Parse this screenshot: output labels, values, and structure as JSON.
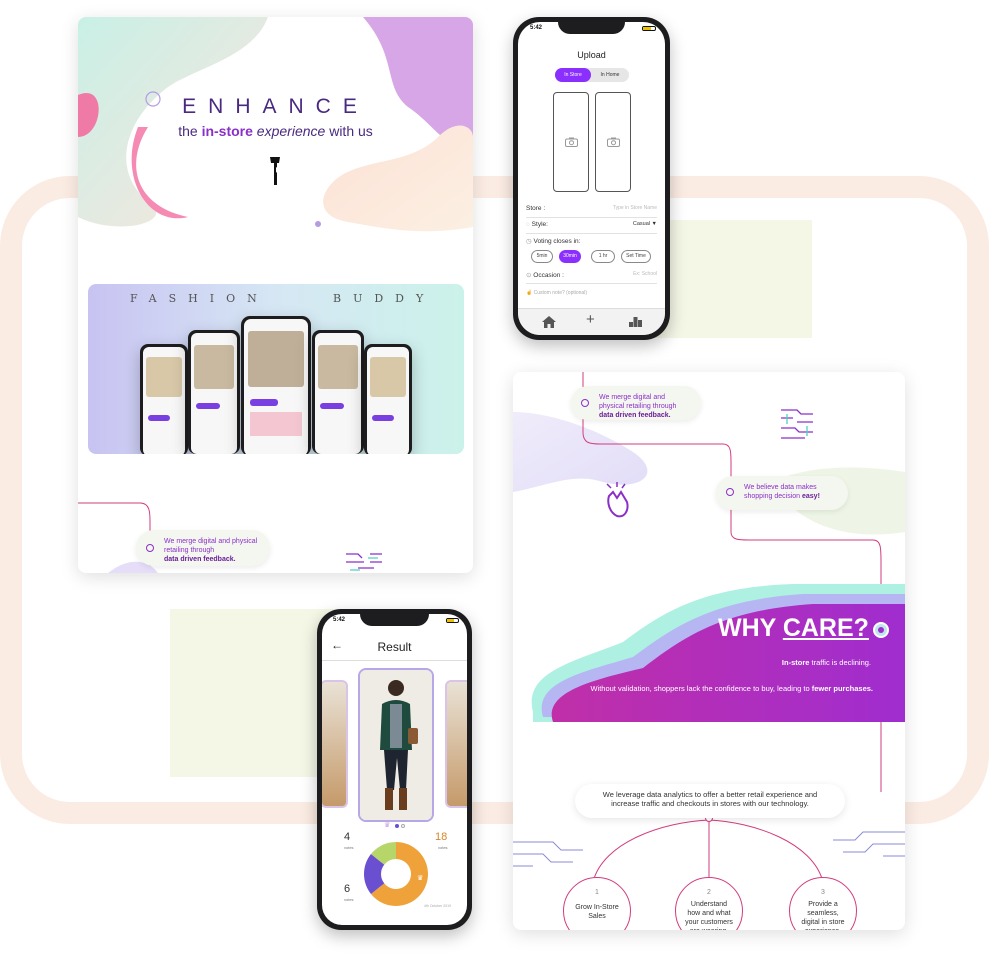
{
  "enhance": {
    "title": "ENHANCE",
    "tagline_pre": "the ",
    "tagline_bold": "in-store",
    "tagline_italic": " experience",
    "tagline_post": " with us",
    "banner_left": "FASHION",
    "banner_right": "BUDDY",
    "merge_text": "We merge digital and physical retailing through",
    "merge_bold": "data driven feedback."
  },
  "upload_phone": {
    "time": "5:42",
    "title": "Upload",
    "tabs": [
      "In Store",
      "In Home"
    ],
    "store_label": "Store :",
    "store_placeholder": "Type in Store Name",
    "style_label": "Style:",
    "style_value": "Casual",
    "voting_label": "Voting closes in:",
    "voting_options": [
      "5min",
      "30min",
      "1 hr",
      "Set Time"
    ],
    "occasion_label": "Occasion :",
    "occasion_placeholder": "Ex: School",
    "custom_note": "Custom note? (optional)"
  },
  "result_phone": {
    "time": "5:42",
    "title": "Result",
    "left_count": "4",
    "left_label": "votes",
    "left_count2": "6",
    "left_label2": "votes",
    "right_count": "18",
    "right_label": "votes",
    "date_text": "4th October 2019",
    "donut": [
      {
        "value": 18,
        "color": "#f0a23a"
      },
      {
        "value": 6,
        "color": "#6a4fd1"
      },
      {
        "value": 4,
        "color": "#b6d66a"
      }
    ]
  },
  "why": {
    "bubble1": "We merge digital and physical retailing through",
    "bubble1_bold": "data driven feedback.",
    "bubble2": "We believe data makes shopping decision",
    "bubble2_bold": "easy!",
    "title_a": "WHY ",
    "title_b": "CARE?",
    "line1_bold": "In-store",
    "line1": " traffic is declining.",
    "line2": "Without validation, shoppers lack the confidence to buy, leading to ",
    "line2_bold": "fewer purchases.",
    "leverage": "We leverage data analytics to offer a better retail experience and increase traffic and checkouts in stores with our technology.",
    "goals": [
      {
        "num": "1",
        "text": "Grow In-Store Sales"
      },
      {
        "num": "2",
        "text": "Understand how and what your customers are wearing."
      },
      {
        "num": "3",
        "text": "Provide a seamless, digital in store experience."
      }
    ]
  },
  "colors": {
    "purple": "#8b2fc9",
    "magenta": "#c02fa8",
    "pink": "#d23d7d",
    "peach": "#fbece3"
  }
}
